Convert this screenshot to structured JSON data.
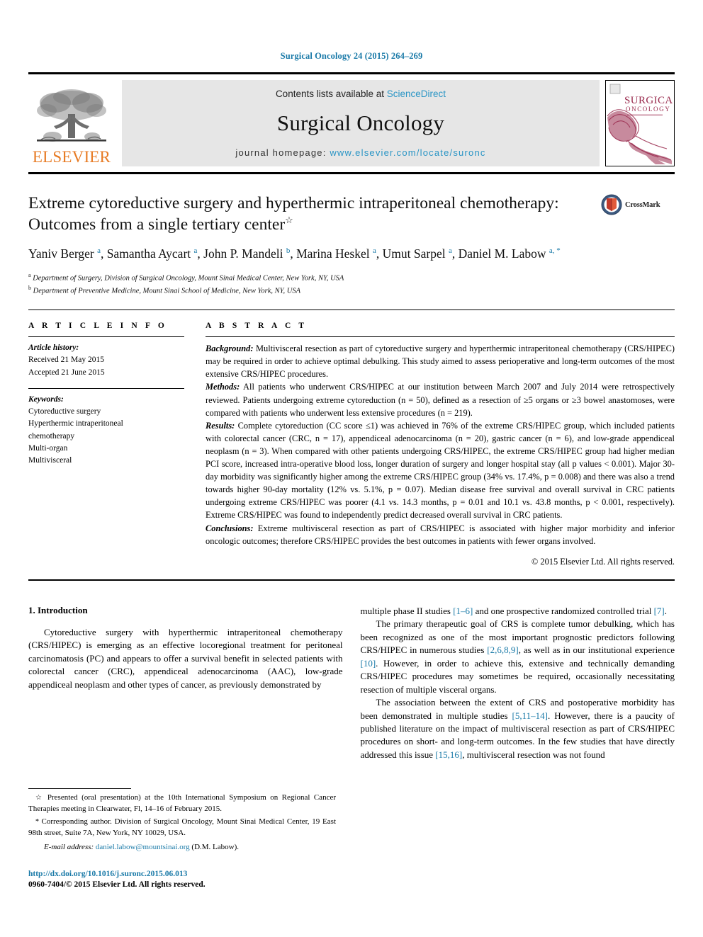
{
  "running_head": "Surgical Oncology 24 (2015) 264–269",
  "masthead": {
    "publisher_name": "ELSEVIER",
    "contents_prefix": "Contents lists available at ",
    "contents_link": "ScienceDirect",
    "journal_title": "Surgical Oncology",
    "homepage_prefix": "journal homepage: ",
    "homepage_url": "www.elsevier.com/locate/suronc",
    "cover_title_line1": "SURGICAL",
    "cover_title_line2": "ONCOLOGY"
  },
  "crossmark": {
    "label": "CrossMark"
  },
  "article": {
    "title": "Extreme cytoreductive surgery and hyperthermic intraperitoneal chemotherapy: Outcomes from a single tertiary center",
    "title_mark": "☆",
    "authors_html": "Yaniv Berger <sup>a</sup>, Samantha Aycart <sup>a</sup>, John P. Mandeli <sup>b</sup>, Marina Heskel <sup>a</sup>, Umut Sarpel <sup>a</sup>, Daniel M. Labow <sup>a, *</sup>",
    "affiliation_a": "Department of Surgery, Division of Surgical Oncology, Mount Sinai Medical Center, New York, NY, USA",
    "affiliation_b": "Department of Preventive Medicine, Mount Sinai School of Medicine, New York, NY, USA"
  },
  "article_info": {
    "heading": "A R T I C L E  I N F O",
    "history_label": "Article history:",
    "received": "Received 21 May 2015",
    "accepted": "Accepted 21 June 2015",
    "keywords_label": "Keywords:",
    "keywords": [
      "Cytoreductive surgery",
      "Hyperthermic intraperitoneal",
      "chemotherapy",
      "Multi-organ",
      "Multivisceral"
    ]
  },
  "abstract": {
    "heading": "A B S T R A C T",
    "background_label": "Background:",
    "background_text": " Multivisceral resection as part of cytoreductive surgery and hyperthermic intraperitoneal chemotherapy (CRS/HIPEC) may be required in order to achieve optimal debulking. This study aimed to assess perioperative and long-term outcomes of the most extensive CRS/HIPEC procedures.",
    "methods_label": "Methods:",
    "methods_text": " All patients who underwent CRS/HIPEC at our institution between March 2007 and July 2014 were retrospectively reviewed. Patients undergoing extreme cytoreduction (n = 50), defined as a resection of ≥5 organs or ≥3 bowel anastomoses, were compared with patients who underwent less extensive procedures (n = 219).",
    "results_label": "Results:",
    "results_text": " Complete cytoreduction (CC score ≤1) was achieved in 76% of the extreme CRS/HIPEC group, which included patients with colorectal cancer (CRC, n = 17), appendiceal adenocarcinoma (n = 20), gastric cancer (n = 6), and low-grade appendiceal neoplasm (n = 3). When compared with other patients undergoing CRS/HIPEC, the extreme CRS/HIPEC group had higher median PCI score, increased intra-operative blood loss, longer duration of surgery and longer hospital stay (all p values < 0.001). Major 30-day morbidity was significantly higher among the extreme CRS/HIPEC group (34% vs. 17.4%, p = 0.008) and there was also a trend towards higher 90-day mortality (12% vs. 5.1%, p = 0.07). Median disease free survival and overall survival in CRC patients undergoing extreme CRS/HIPEC was poorer (4.1 vs. 14.3 months, p = 0.01 and 10.1 vs. 43.8 months, p < 0.001, respectively). Extreme CRS/HIPEC was found to independently predict decreased overall survival in CRC patients.",
    "conclusions_label": "Conclusions:",
    "conclusions_text": " Extreme multivisceral resection as part of CRS/HIPEC is associated with higher major morbidity and inferior oncologic outcomes; therefore CRS/HIPEC provides the best outcomes in patients with fewer organs involved.",
    "copyright": "© 2015 Elsevier Ltd. All rights reserved."
  },
  "body": {
    "intro_heading": "1. Introduction",
    "left_para_1": "Cytoreductive surgery with hyperthermic intraperitoneal chemotherapy (CRS/HIPEC) is emerging as an effective locoregional treatment for peritoneal carcinomatosis (PC) and appears to offer a survival benefit in selected patients with colorectal cancer (CRC), appendiceal adenocarcinoma (AAC), low-grade appendiceal neoplasm and other types of cancer, as previously demonstrated by",
    "right_para_1_a": "multiple phase II studies ",
    "right_para_1_ref1": "[1–6]",
    "right_para_1_b": " and one prospective randomized controlled trial ",
    "right_para_1_ref2": "[7]",
    "right_para_1_c": ".",
    "right_para_2_a": "The primary therapeutic goal of CRS is complete tumor debulking, which has been recognized as one of the most important prognostic predictors following CRS/HIPEC in numerous studies ",
    "right_para_2_ref1": "[2,6,8,9]",
    "right_para_2_b": ", as well as in our institutional experience ",
    "right_para_2_ref2": "[10]",
    "right_para_2_c": ". However, in order to achieve this, extensive and technically demanding CRS/HIPEC procedures may sometimes be required, occasionally necessitating resection of multiple visceral organs.",
    "right_para_3_a": "The association between the extent of CRS and postoperative morbidity has been demonstrated in multiple studies ",
    "right_para_3_ref1": "[5,11–14]",
    "right_para_3_b": ". However, there is a paucity of published literature on the impact of multivisceral resection as part of CRS/HIPEC procedures on short- and long-term outcomes. In the few studies that have directly addressed this issue ",
    "right_para_3_ref2": "[15,16]",
    "right_para_3_c": ", multivisceral resection was not found"
  },
  "footnotes": {
    "star_note": "Presented (oral presentation) at the 10th International Symposium on Regional Cancer Therapies meeting in Clearwater, Fl, 14–16 of February 2015.",
    "corresponding_note": "Corresponding author. Division of Surgical Oncology, Mount Sinai Medical Center, 19 East 98th street, Suite 7A, New York, NY 10029, USA.",
    "email_label": "E-mail address:",
    "email_address": "daniel.labow@mountsinai.org",
    "email_owner": "(D.M. Labow).",
    "doi": "http://dx.doi.org/10.1016/j.suronc.2015.06.013",
    "issn_line": "0960-7404/© 2015 Elsevier Ltd. All rights reserved."
  },
  "colors": {
    "link_blue": "#1a7aa8",
    "sciencedirect_blue": "#2a95c5",
    "elsevier_orange": "#E77B24",
    "masthead_gray": "#e6e6e6",
    "cover_maroon": "#9a2b4e"
  }
}
